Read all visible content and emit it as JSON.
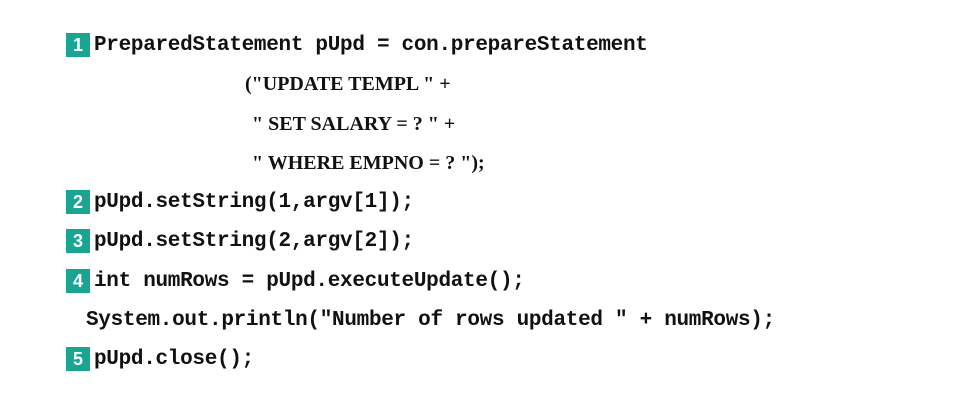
{
  "code_listing": {
    "lines": [
      {
        "badge": "1",
        "text": "PreparedStatement pUpd = con.prepareStatement"
      },
      {
        "badge": "",
        "text": "(\"UPDATE TEMPL \" +"
      },
      {
        "badge": "",
        "text": "\" SET SALARY = ? \" +"
      },
      {
        "badge": "",
        "text": "\" WHERE EMPNO = ? \");"
      },
      {
        "badge": "2",
        "text": "pUpd.setString(1,argv[1]);"
      },
      {
        "badge": "3",
        "text": "pUpd.setString(2,argv[2]);"
      },
      {
        "badge": "4",
        "text": "int numRows = pUpd.executeUpdate();"
      },
      {
        "badge": "",
        "text": "System.out.println(\"Number of rows updated \" + numRows);"
      },
      {
        "badge": "5",
        "text": "pUpd.close();"
      }
    ]
  },
  "colors": {
    "badge_background": "#1aa592",
    "badge_text": "#ffffff",
    "code_text": "#111111"
  }
}
